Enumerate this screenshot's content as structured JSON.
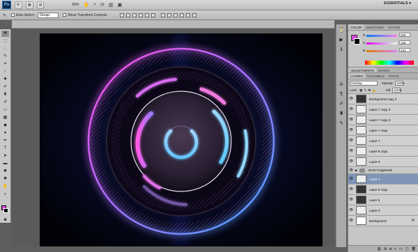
{
  "appbar": {
    "logo": "Ps",
    "zoom": "50%",
    "workspace": "ESSENTIALS",
    "workspace_arrow": "▾",
    "icons": [
      "bridge-icon",
      "mini-bridge-icon",
      "hand-tool-icon",
      "zoom-tool-icon",
      "rotate-view-icon",
      "arrange-documents-icon",
      "screen-mode-icon"
    ]
  },
  "options": {
    "auto_select_label": "Auto-Select:",
    "auto_select_value": "Group",
    "show_transform_label": "Show Transform Controls"
  },
  "color_panel": {
    "tabs": [
      "COLOR",
      "SWATCHES",
      "STYLES"
    ],
    "channels": [
      {
        "label": "R",
        "value": "225"
      },
      {
        "label": "G",
        "value": "126"
      },
      {
        "label": "B",
        "value": "241"
      }
    ],
    "foreground": "#e17ef1",
    "background": "#000000"
  },
  "adjustments_panel": {
    "tabs": [
      "ADJUSTMENTS",
      "MASKS"
    ]
  },
  "layers_panel": {
    "tabs": [
      "LAYERS",
      "CHANNELS",
      "PATHS"
    ],
    "blend_mode": "Overlay",
    "opacity_label": "Opacity:",
    "opacity": "100%",
    "lock_label": "Lock:",
    "fill_label": "Fill:",
    "fill": "100%",
    "layers": [
      {
        "name": "Background copy 2",
        "thumb": "dark",
        "selected": false
      },
      {
        "name": "Layer 7 copy 3",
        "thumb": "trans",
        "selected": false
      },
      {
        "name": "Layer 7 copy 2",
        "thumb": "trans",
        "selected": false
      },
      {
        "name": "Layer 7 copy",
        "thumb": "trans",
        "selected": false
      },
      {
        "name": "Layer 7",
        "thumb": "trans",
        "selected": false
      },
      {
        "name": "Layer 6 copy",
        "thumb": "trans",
        "selected": false
      },
      {
        "name": "Layer 6",
        "thumb": "trans",
        "selected": false
      }
    ],
    "group": {
      "name": "Circle Fragments"
    },
    "layers2": [
      {
        "name": "Layer 4",
        "thumb": "trans",
        "selected": true
      },
      {
        "name": "Layer 5 copy",
        "thumb": "dark",
        "selected": false
      },
      {
        "name": "Layer 5",
        "thumb": "dark",
        "selected": false
      },
      {
        "name": "Layer 3",
        "thumb": "trans",
        "selected": false
      },
      {
        "name": "Background",
        "thumb": "white",
        "selected": false,
        "fx": "fx"
      }
    ]
  }
}
